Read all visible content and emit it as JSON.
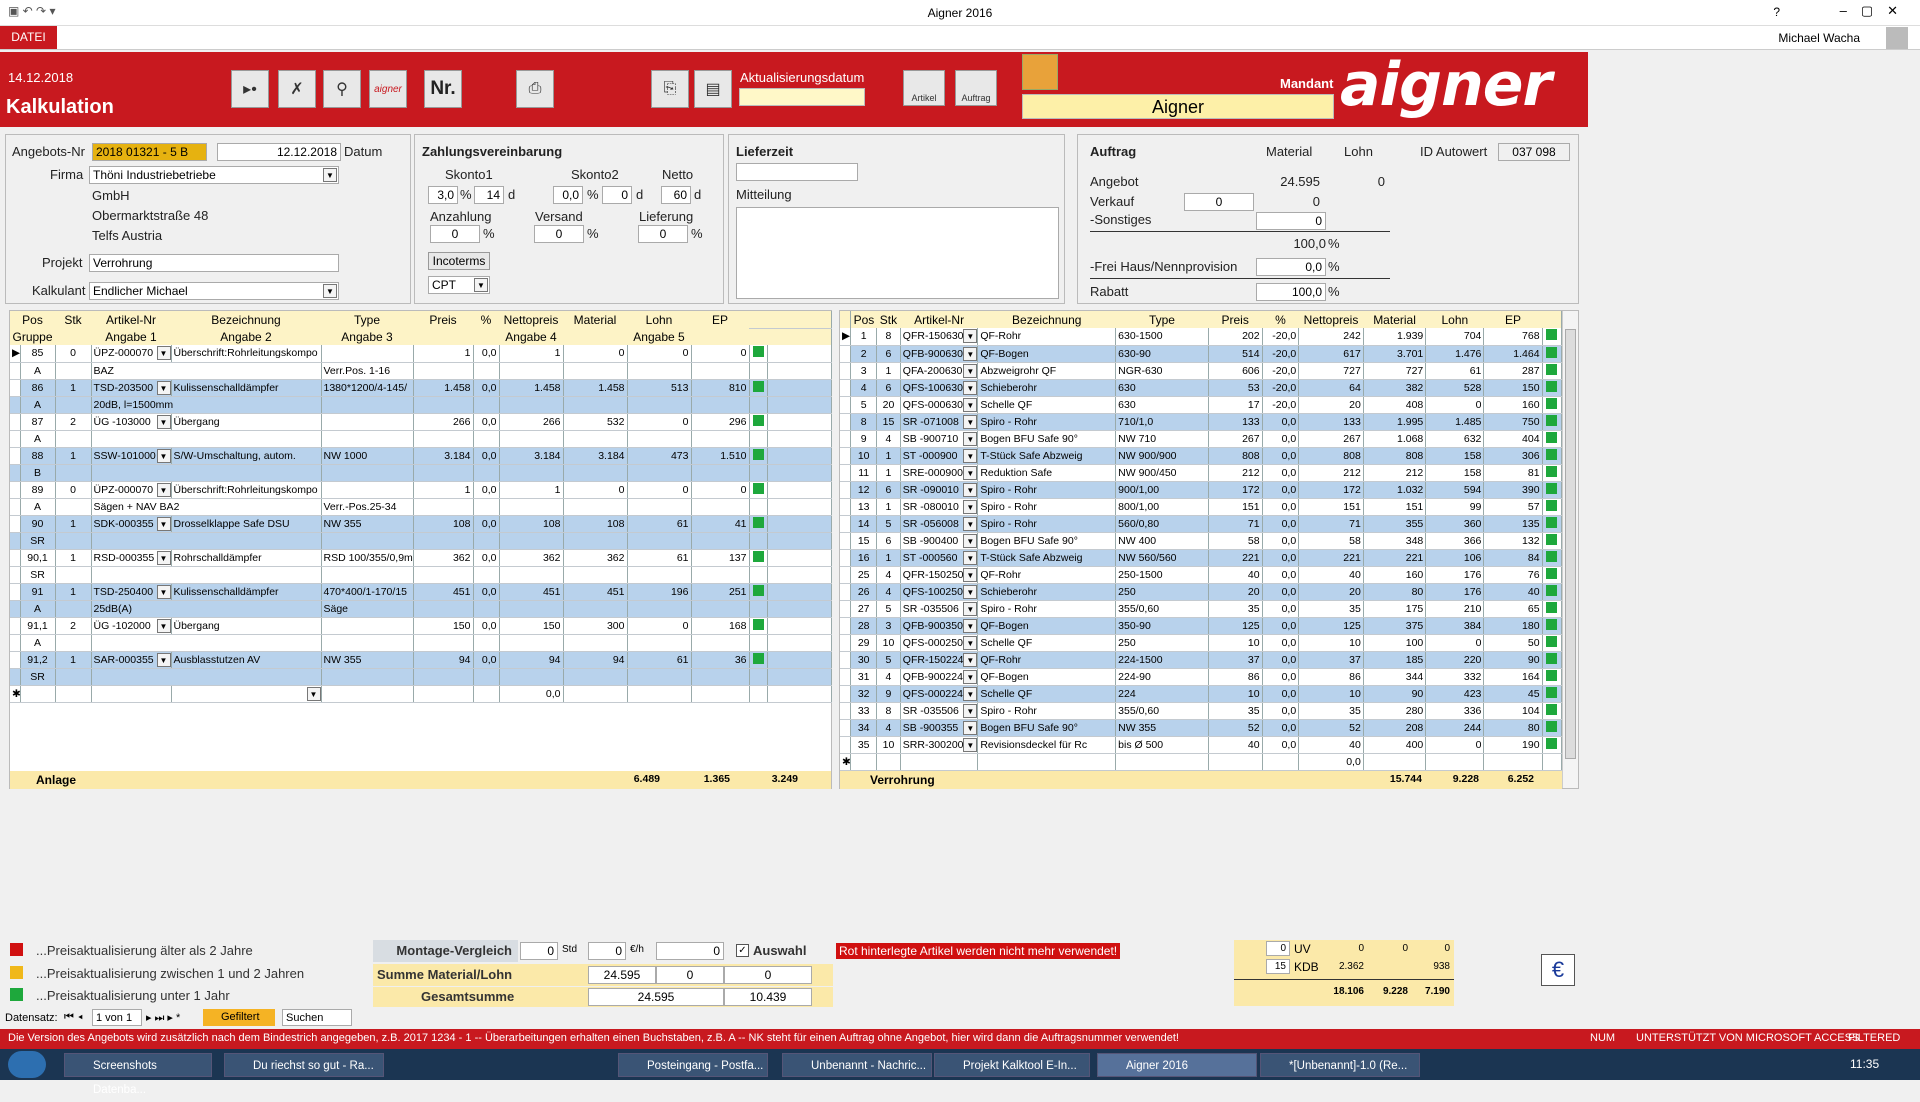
{
  "window": {
    "title": "Aigner 2016",
    "user": "Michael Wacha",
    "help": "?",
    "menu_tab": "DATEI"
  },
  "header": {
    "date": "14.12.2018",
    "title": "Kalkulation",
    "nr_label": "Nr.",
    "update_label": "Aktualisierungsdatum",
    "artikel_label": "Artikel",
    "auftrag_label": "Auftrag",
    "mandant_label": "Mandant",
    "mandant_value": "Aigner",
    "logo_text": "aigner"
  },
  "offer": {
    "angebots_nr_label": "Angebots-Nr",
    "angebots_nr": "2018 01321 - 5 B",
    "datum_value": "12.12.2018",
    "datum_label": "Datum",
    "firma_label": "Firma",
    "firma": "Thöni Industriebetriebe",
    "addr1": "GmbH",
    "addr2": "Obermarktstraße 48",
    "addr3": "Telfs Austria",
    "projekt_label": "Projekt",
    "projekt": "Verrohrung",
    "kalkulant_label": "Kalkulant",
    "kalkulant": "Endlicher Michael"
  },
  "payment": {
    "title": "Zahlungsvereinbarung",
    "skonto1_label": "Skonto1",
    "skonto1_pct": "3,0",
    "skonto1_days": "14",
    "skonto2_label": "Skonto2",
    "skonto2_pct": "0,0",
    "skonto2_days": "0",
    "netto_label": "Netto",
    "netto_days": "60",
    "pct": "%",
    "d": "d",
    "anzahlung_label": "Anzahlung",
    "anzahlung": "0",
    "versand_label": "Versand",
    "versand": "0",
    "lieferung_label": "Lieferung",
    "lieferung": "0",
    "incoterms_label": "Incoterms",
    "incoterms": "CPT"
  },
  "delivery": {
    "lieferzeit_label": "Lieferzeit",
    "mitteilung_label": "Mitteilung"
  },
  "order": {
    "auftrag_label": "Auftrag",
    "material_label": "Material",
    "lohn_label": "Lohn",
    "id_label": "ID Autowert",
    "id_value": "037 098",
    "angebot_label": "Angebot",
    "angebot_material": "24.595",
    "angebot_lohn": "0",
    "verkauf_label": "Verkauf",
    "verkauf_input": "0",
    "verkauf_lohn": "0",
    "sonstiges_label": "-Sonstiges",
    "sonstiges": "0",
    "pct100": "100,0",
    "pct_sign": "%",
    "frei_label": "-Frei Haus/Nennprovision",
    "frei": "0,0",
    "rabatt_label": "Rabatt",
    "rabatt": "100,0"
  },
  "left_grid": {
    "headers1": [
      "Pos",
      "Stk",
      "Artikel-Nr",
      "Bezeichnung",
      "Type",
      "Preis",
      "%",
      "Nettopreis",
      "Material",
      "Lohn",
      "EP"
    ],
    "headers2": [
      "Gruppe",
      "",
      "Angabe 1",
      "Angabe 2",
      "Angabe 3",
      "",
      "",
      "Angabe 4",
      "",
      "Angabe 5",
      ""
    ],
    "rows": [
      {
        "pos": "85",
        "stk": "0",
        "art": "ÜPZ-000070",
        "bez": "Überschrift:Rohrleitungskompo",
        "typ": "",
        "preis": "1",
        "pct": "0,0",
        "netto": "1",
        "mat": "0",
        "lohn": "0",
        "ep": "0",
        "g": "A",
        "a1": "BAZ",
        "a2": "Verr.Pos. 1-16",
        "color": "white"
      },
      {
        "pos": "86",
        "stk": "1",
        "art": "TSD-203500",
        "bez": "Kulissenschalldämpfer",
        "typ": "1380*1200/4-145/",
        "preis": "1.458",
        "pct": "0,0",
        "netto": "1.458",
        "mat": "1.458",
        "lohn": "513",
        "ep": "810",
        "g": "A",
        "a1": "20dB, l=1500mm",
        "a2": "",
        "color": "blue"
      },
      {
        "pos": "87",
        "stk": "2",
        "art": "ÜG -103000",
        "bez": "Übergang",
        "typ": "",
        "preis": "266",
        "pct": "0,0",
        "netto": "266",
        "mat": "532",
        "lohn": "0",
        "ep": "296",
        "g": "A",
        "a1": "",
        "a2": "",
        "color": "white"
      },
      {
        "pos": "88",
        "stk": "1",
        "art": "SSW-101000",
        "bez": "S/W-Umschaltung, autom.",
        "typ": "NW 1000",
        "preis": "3.184",
        "pct": "0,0",
        "netto": "3.184",
        "mat": "3.184",
        "lohn": "473",
        "ep": "1.510",
        "g": "B",
        "a1": "",
        "a2": "",
        "color": "blue"
      },
      {
        "pos": "89",
        "stk": "0",
        "art": "ÜPZ-000070",
        "bez": "Überschrift:Rohrleitungskompo",
        "typ": "",
        "preis": "1",
        "pct": "0,0",
        "netto": "1",
        "mat": "0",
        "lohn": "0",
        "ep": "0",
        "g": "A",
        "a1": "Sägen + NAV BA2",
        "a2": "Verr.-Pos.25-34",
        "color": "white"
      },
      {
        "pos": "90",
        "stk": "1",
        "art": "SDK-000355",
        "bez": "Drosselklappe Safe DSU",
        "typ": "NW 355",
        "preis": "108",
        "pct": "0,0",
        "netto": "108",
        "mat": "108",
        "lohn": "61",
        "ep": "41",
        "g": "SR",
        "a1": "",
        "a2": "",
        "color": "blue"
      },
      {
        "pos": "90,1",
        "stk": "1",
        "art": "RSD-000355",
        "bez": "Rohrschalldämpfer",
        "typ": "RSD 100/355/0,9m",
        "preis": "362",
        "pct": "0,0",
        "netto": "362",
        "mat": "362",
        "lohn": "61",
        "ep": "137",
        "g": "SR",
        "a1": "",
        "a2": "",
        "color": "white"
      },
      {
        "pos": "91",
        "stk": "1",
        "art": "TSD-250400",
        "bez": "Kulissenschalldämpfer",
        "typ": "470*400/1-170/15",
        "preis": "451",
        "pct": "0,0",
        "netto": "451",
        "mat": "451",
        "lohn": "196",
        "ep": "251",
        "g": "A",
        "a1": "25dB(A)",
        "a2": "Säge",
        "color": "blue"
      },
      {
        "pos": "91,1",
        "stk": "2",
        "art": "ÜG -102000",
        "bez": "Übergang",
        "typ": "",
        "preis": "150",
        "pct": "0,0",
        "netto": "150",
        "mat": "300",
        "lohn": "0",
        "ep": "168",
        "g": "A",
        "a1": "",
        "a2": "",
        "color": "white"
      },
      {
        "pos": "91,2",
        "stk": "1",
        "art": "SAR-000355",
        "bez": "Ausblasstutzen AV",
        "typ": "NW 355",
        "preis": "94",
        "pct": "0,0",
        "netto": "94",
        "mat": "94",
        "lohn": "61",
        "ep": "36",
        "g": "SR",
        "a1": "",
        "a2": "",
        "color": "blue"
      }
    ],
    "new_pct": "0,0",
    "footer": {
      "label": "Anlage",
      "material": "6.489",
      "lohn": "1.365",
      "ep": "3.249"
    }
  },
  "right_grid": {
    "headers": [
      "Pos",
      "Stk",
      "Artikel-Nr",
      "Bezeichnung",
      "Type",
      "Preis",
      "%",
      "Nettopreis",
      "Material",
      "Lohn",
      "EP"
    ],
    "rows": [
      [
        "1",
        "8",
        "QFR-150630",
        "QF-Rohr",
        "630-1500",
        "202",
        "-20,0",
        "242",
        "1.939",
        "704",
        "768"
      ],
      [
        "2",
        "6",
        "QFB-900630",
        "QF-Bogen",
        "630-90",
        "514",
        "-20,0",
        "617",
        "3.701",
        "1.476",
        "1.464"
      ],
      [
        "3",
        "1",
        "QFA-200630",
        "Abzweigrohr QF",
        "NGR-630",
        "606",
        "-20,0",
        "727",
        "727",
        "61",
        "287"
      ],
      [
        "4",
        "6",
        "QFS-100630",
        "Schieberohr",
        "630",
        "53",
        "-20,0",
        "64",
        "382",
        "528",
        "150"
      ],
      [
        "5",
        "20",
        "QFS-000630",
        "Schelle QF",
        "630",
        "17",
        "-20,0",
        "20",
        "408",
        "0",
        "160"
      ],
      [
        "8",
        "15",
        "SR -071008",
        "Spiro - Rohr",
        "710/1,0",
        "133",
        "0,0",
        "133",
        "1.995",
        "1.485",
        "750"
      ],
      [
        "9",
        "4",
        "SB -900710",
        "Bogen BFU Safe 90°",
        "NW 710",
        "267",
        "0,0",
        "267",
        "1.068",
        "632",
        "404"
      ],
      [
        "10",
        "1",
        "ST -000900",
        "T-Stück Safe Abzweig",
        "NW 900/900",
        "808",
        "0,0",
        "808",
        "808",
        "158",
        "306"
      ],
      [
        "11",
        "1",
        "SRE-000900",
        "Reduktion Safe",
        "NW 900/450",
        "212",
        "0,0",
        "212",
        "212",
        "158",
        "81"
      ],
      [
        "12",
        "6",
        "SR -090010",
        "Spiro - Rohr",
        "900/1,00",
        "172",
        "0,0",
        "172",
        "1.032",
        "594",
        "390"
      ],
      [
        "13",
        "1",
        "SR -080010",
        "Spiro - Rohr",
        "800/1,00",
        "151",
        "0,0",
        "151",
        "151",
        "99",
        "57"
      ],
      [
        "14",
        "5",
        "SR -056008",
        "Spiro - Rohr",
        "560/0,80",
        "71",
        "0,0",
        "71",
        "355",
        "360",
        "135"
      ],
      [
        "15",
        "6",
        "SB -900400",
        "Bogen BFU Safe 90°",
        "NW 400",
        "58",
        "0,0",
        "58",
        "348",
        "366",
        "132"
      ],
      [
        "16",
        "1",
        "ST -000560",
        "T-Stück Safe Abzweig",
        "NW 560/560",
        "221",
        "0,0",
        "221",
        "221",
        "106",
        "84"
      ],
      [
        "25",
        "4",
        "QFR-150250",
        "QF-Rohr",
        "250-1500",
        "40",
        "0,0",
        "40",
        "160",
        "176",
        "76"
      ],
      [
        "26",
        "4",
        "QFS-100250",
        "Schieberohr",
        "250",
        "20",
        "0,0",
        "20",
        "80",
        "176",
        "40"
      ],
      [
        "27",
        "5",
        "SR -035506",
        "Spiro - Rohr",
        "355/0,60",
        "35",
        "0,0",
        "35",
        "175",
        "210",
        "65"
      ],
      [
        "28",
        "3",
        "QFB-900350",
        "QF-Bogen",
        "350-90",
        "125",
        "0,0",
        "125",
        "375",
        "384",
        "180"
      ],
      [
        "29",
        "10",
        "QFS-000250",
        "Schelle QF",
        "250",
        "10",
        "0,0",
        "10",
        "100",
        "0",
        "50"
      ],
      [
        "30",
        "5",
        "QFR-150224",
        "QF-Rohr",
        "224-1500",
        "37",
        "0,0",
        "37",
        "185",
        "220",
        "90"
      ],
      [
        "31",
        "4",
        "QFB-900224",
        "QF-Bogen",
        "224-90",
        "86",
        "0,0",
        "86",
        "344",
        "332",
        "164"
      ],
      [
        "32",
        "9",
        "QFS-000224",
        "Schelle QF",
        "224",
        "10",
        "0,0",
        "10",
        "90",
        "423",
        "45"
      ],
      [
        "33",
        "8",
        "SR -035506",
        "Spiro - Rohr",
        "355/0,60",
        "35",
        "0,0",
        "35",
        "280",
        "336",
        "104"
      ],
      [
        "34",
        "4",
        "SB -900355",
        "Bogen BFU Safe 90°",
        "NW 355",
        "52",
        "0,0",
        "52",
        "208",
        "244",
        "80"
      ],
      [
        "35",
        "10",
        "SRR-300200",
        "Revisionsdeckel für Rc",
        "bis Ø 500",
        "40",
        "0,0",
        "40",
        "400",
        "0",
        "190"
      ]
    ],
    "new_pct": "0,0",
    "footer": {
      "label": "Verrohrung",
      "material": "15.744",
      "lohn": "9.228",
      "ep": "6.252"
    }
  },
  "legend": {
    "red": "...Preisaktualisierung älter als 2 Jahre",
    "yellow": "...Preisaktualisierung zwischen 1 und 2 Jahren",
    "green": "...Preisaktualisierung unter 1 Jahr"
  },
  "montage": {
    "label": "Montage-Vergleich",
    "std_val": "0",
    "std_unit": "Std",
    "eur_val": "0",
    "eur_unit": "€/h",
    "total": "0",
    "auswahl": "Auswahl",
    "summe_label": "Summe Material/Lohn",
    "summe_mat": "24.595",
    "summe_a": "0",
    "summe_b": "0",
    "gesamt_label": "Gesamtsumme",
    "gesamt_mat": "24.595",
    "gesamt_b": "10.439"
  },
  "warning": "Rot hinterlegte Artikel werden nicht mehr verwendet!",
  "summary": {
    "uv_pct": "0",
    "uv_label": "UV",
    "uv1": "0",
    "uv2": "0",
    "uv3": "0",
    "kdb_pct": "15",
    "kdb_label": "KDB",
    "kdb1": "2.362",
    "kdb2": "",
    "kdb3": "938",
    "t1": "18.106",
    "t2": "9.228",
    "t3": "7.190"
  },
  "nav": {
    "label": "Datensatz:",
    "record": "1 von 1",
    "filter": "Gefiltert",
    "search": "Suchen"
  },
  "statusbar": {
    "text": "Die Version des Angebots wird zusätzlich nach dem Bindestrich angegeben, z.B. 2017 1234 - 1    --    Überarbeitungen erhalten einen Buchstaben, z.B. A    --    NK steht für einen Auftrag ohne Angebot, hier wird dann die Auftragsnummer verwendet!",
    "num": "NUM",
    "access": "UNTERSTÜTZT VON MICROSOFT ACCESS",
    "filtered": "FILTERED"
  },
  "taskbar": {
    "items": [
      "Screenshots Datenba...",
      "Du riechst so gut - Ra...",
      "Posteingang - Postfa...",
      "Unbenannt - Nachric...",
      "Projekt Kalktool E-In...",
      "Aigner 2016",
      "*[Unbenannt]-1.0 (Re..."
    ],
    "time": "11:35"
  },
  "colors": {
    "brand": "#c8191f",
    "row_blue": "#b8d2ec",
    "grid_header": "#fdf3c6",
    "ok_green": "#1ea83c"
  }
}
